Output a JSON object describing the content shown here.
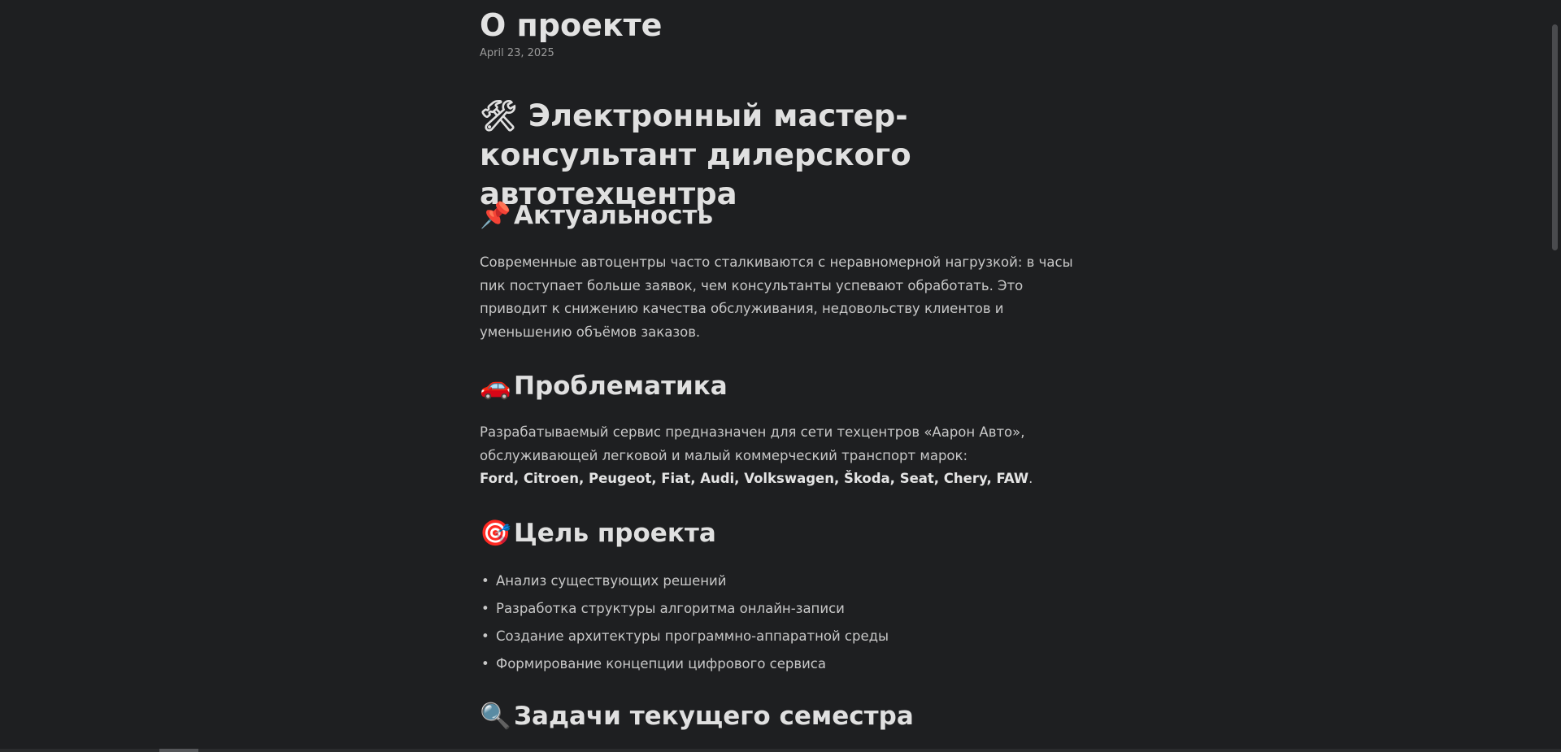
{
  "page": {
    "title": "О проекте",
    "date": "April 23, 2025"
  },
  "article": {
    "heading_emoji": "🛠",
    "heading": "Электронный мастер-консультант дилерского автотехцентра",
    "relevance": {
      "emoji": "📌",
      "title": "Актуальность",
      "text": "Современные автоцентры часто сталкиваются с неравномерной нагрузкой: в часы пик поступает больше заявок, чем консультанты успевают обработать. Это приводит к снижению качества обслуживания, недовольству клиентов и уменьшению объёмов заказов."
    },
    "problem": {
      "emoji": "🚗",
      "title": "Проблематика",
      "text": "Разрабатываемый сервис предназначен для сети техцентров «Аарон Авто», обслуживающей легковой и малый коммерческий транспорт марок:",
      "brands": "Ford, Citroen, Peugeot, Fiat, Audi, Volkswagen, Škoda, Seat, Chery, FAW",
      "brands_end": "."
    },
    "goal": {
      "emoji": "🎯",
      "title": "Цель проекта",
      "items": [
        "Анализ существующих решений",
        "Разработка структуры алгоритма онлайн-записи",
        "Создание архитектуры программно-аппаратной среды",
        "Формирование концепции цифрового сервиса"
      ]
    },
    "tasks": {
      "emoji": "🔍",
      "title": "Задачи текущего семестра"
    }
  },
  "colors": {
    "background": "#1e1f21",
    "heading_text": "#e0e0e0",
    "body_text": "#c8c8c8",
    "muted_text": "#9a9a9a"
  }
}
